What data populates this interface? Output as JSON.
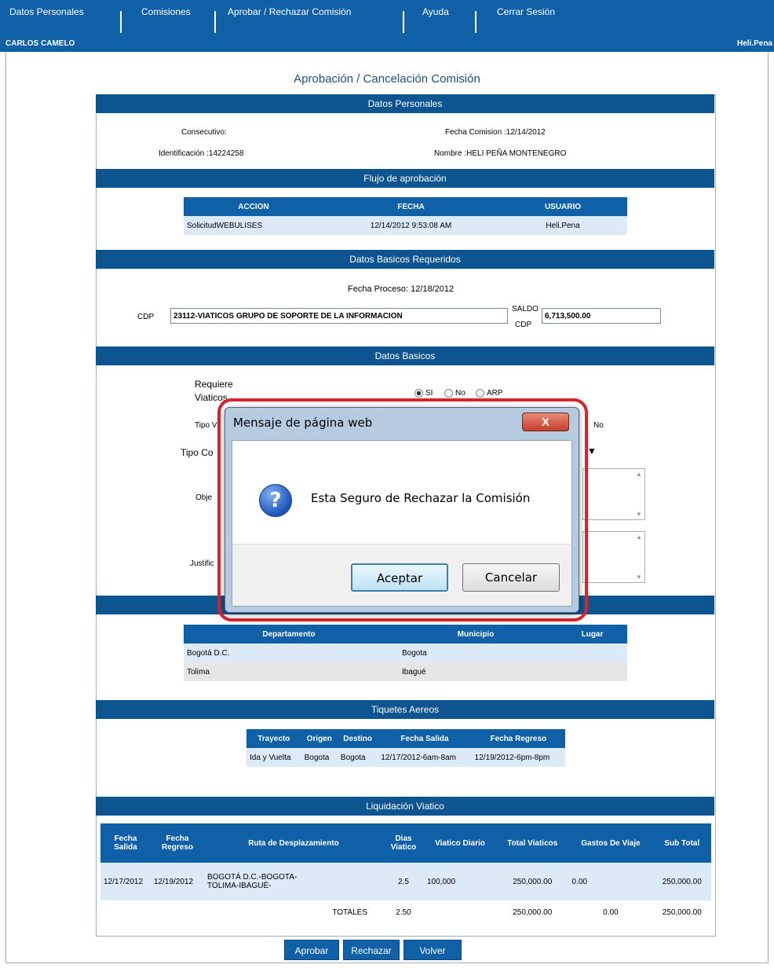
{
  "nav": {
    "items": [
      "Datos Personales",
      "Comisiones",
      "Aprobar / Rechazar Comisión",
      "Ayuda",
      "Cerrar Sesión"
    ],
    "user_left": "CARLOS CAMELO",
    "user_right": "Heli.Pena"
  },
  "page_title": "Aprobación / Cancelación Comisión",
  "datos_personales": {
    "header": "Datos Personales",
    "consecutivo": "Consecutivo:",
    "fecha_comision": "Fecha Comision :12/14/2012",
    "identificacion": "Identificación :14224258",
    "nombre": "Nombre :HELI PEÑA MONTENEGRO"
  },
  "flujo": {
    "header": "Flujo de aprobación",
    "columns": [
      "ACCION",
      "FECHA",
      "USUARIO"
    ],
    "rows": [
      [
        "SolicitudWEBULISES",
        "12/14/2012 9:53:08 AM",
        "Heli.Pena"
      ]
    ]
  },
  "datos_basicos_req": {
    "header": "Datos Basicos Requeridos",
    "fecha_proceso": "Fecha Proceso: 12/18/2012",
    "cdp_label": "CDP",
    "cdp_value": "23112-VIATICOS GRUPO DE SOPORTE DE LA INFORMACION",
    "saldo_label_1": "SALDO",
    "saldo_label_2": "CDP",
    "saldo_value": "6,713,500.00"
  },
  "datos_basicos": {
    "header": "Datos Basicos",
    "requiere_1": "Requiere",
    "requiere_2": "Viaticos",
    "opt_si": "SI",
    "opt_no": "No",
    "opt_arp": "ARP",
    "tipo_label": "Tipo V",
    "tipo_no": "No",
    "tipo_co": "Tipo  Co",
    "objeto": "Obje",
    "justificacion": "Justific"
  },
  "destinos": {
    "columns": [
      "Departamento",
      "Municipio",
      "Lugar"
    ],
    "rows": [
      [
        "Bogotá D.C.",
        "Bogota",
        ""
      ],
      [
        "Tolima",
        "Ibagué",
        ""
      ]
    ]
  },
  "tiquetes": {
    "header": "Tiquetes Aereos",
    "columns": [
      "Trayecto",
      "Origen",
      "Destino",
      "Fecha Salida",
      "Fecha Regreso"
    ],
    "rows": [
      [
        "Ida y Vuelta",
        "Bogota",
        "Bogota",
        "12/17/2012-6am-8am",
        "12/19/2012-6pm-8pm"
      ]
    ]
  },
  "liquidacion": {
    "header": "Liquidación Viatico",
    "col_salida_1": "Fecha",
    "col_salida_2": "Salida",
    "col_regreso_1": "Fecha",
    "col_regreso_2": "Regreso",
    "col_ruta": "Ruta de Desplazamiento",
    "col_dias_1": "Dias",
    "col_dias_2": "Viatico",
    "col_diario": "Viatico Diario",
    "col_total": "Total Viaticos",
    "col_gastos": "Gastos De Viaje",
    "col_sub": "Sub Total",
    "row": {
      "salida": "12/17/2012",
      "regreso": "12/19/2012",
      "ruta_1": "BOGOTÁ D.C.-BOGOTA-",
      "ruta_2": "TOLIMA-IBAGUÉ-",
      "dias": "2.5",
      "diario": "100,000",
      "total": "250,000.00",
      "gastos": "0.00",
      "sub": "250,000.00"
    },
    "totales": {
      "label": "TOTALES",
      "dias": "2.50",
      "total": "250,000.00",
      "gastos": "0.00",
      "sub": "250,000.00"
    }
  },
  "buttons": {
    "aprobar": "Aprobar",
    "rechazar": "Rechazar",
    "volver": "Volver"
  },
  "dialog": {
    "title": "Mensaje de página web",
    "close": "X",
    "message": "Esta Seguro de Rechazar la Comisión",
    "ok": "Aceptar",
    "cancel": "Cancelar",
    "icon": "question-icon"
  },
  "colors": {
    "nav_bg": "#1060a8",
    "section_header": "#0d5590",
    "highlight_outline": "#d9242c"
  }
}
